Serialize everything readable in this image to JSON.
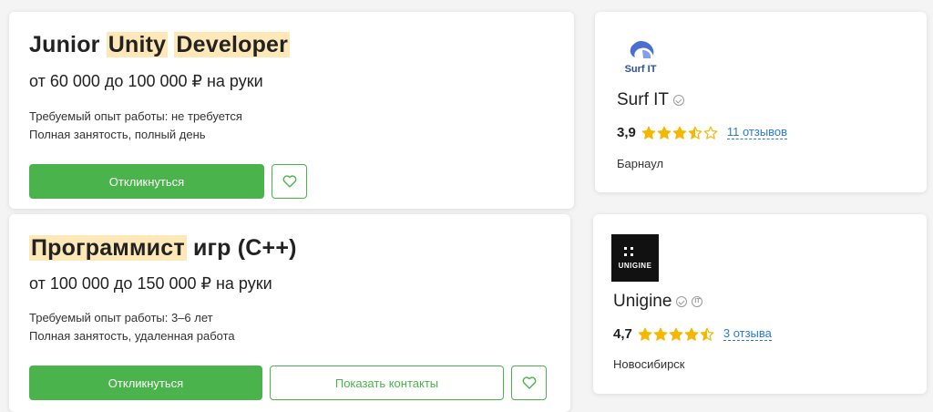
{
  "vacancies": [
    {
      "title_parts": [
        {
          "text": "Junior ",
          "highlight": false
        },
        {
          "text": "Unity",
          "highlight": true
        },
        {
          "text": " ",
          "highlight": false
        },
        {
          "text": "Developer",
          "highlight": true
        }
      ],
      "salary": "от 60 000 до 100 000 ₽ на руки",
      "experience": "Требуемый опыт работы: не требуется",
      "employment": "Полная занятость, полный день",
      "apply_label": "Откликнуться",
      "favorite_icon": "heart-icon"
    },
    {
      "title_parts": [
        {
          "text": "Программист",
          "highlight": true
        },
        {
          "text": " игр (C++)",
          "highlight": false
        }
      ],
      "salary": "от 100 000 до 150 000 ₽ на руки",
      "experience": "Требуемый опыт работы: 3–6 лет",
      "employment": "Полная занятость, удаленная работа",
      "apply_label": "Откликнуться",
      "contacts_label": "Показать контакты",
      "favorite_icon": "heart-icon"
    }
  ],
  "employers": [
    {
      "name": "Surf IT",
      "logo_text": "Surf IT",
      "rating": "3,9",
      "stars": 3.5,
      "reviews": "11 отзывов",
      "city": "Барнаул"
    },
    {
      "name": "Unigine",
      "logo_text": "UNIGINE",
      "it_badge": "IT",
      "rating": "4,7",
      "stars": 4.5,
      "reviews": "3 отзыва",
      "city": "Новосибирск"
    }
  ],
  "colors": {
    "accent_green": "#4bb34b",
    "highlight": "#ffe8b8",
    "star": "#f5b800",
    "link": "#2b7bd6"
  }
}
